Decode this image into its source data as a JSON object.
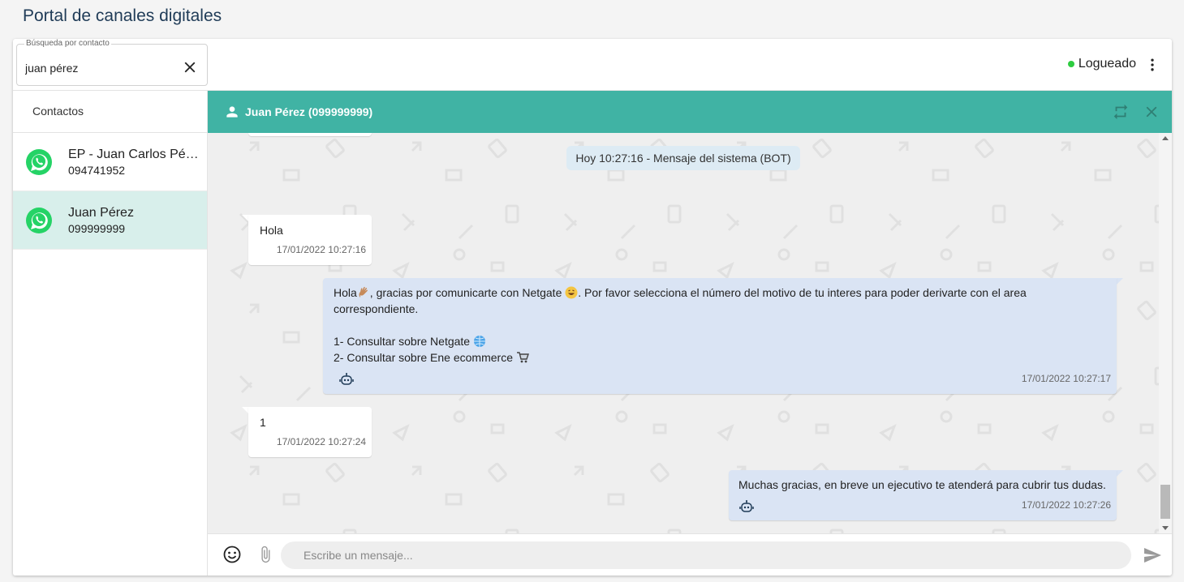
{
  "page": {
    "title": "Portal de canales digitales"
  },
  "search": {
    "label": "Búsqueda por contacto",
    "value": "juan pérez"
  },
  "status": {
    "label": "Logueado",
    "color": "#2ecc40"
  },
  "sidebar": {
    "header": "Contactos",
    "contacts": [
      {
        "name": "EP - Juan Carlos Pérez",
        "phone": "094741952",
        "icon": "whatsapp-icon",
        "active": false
      },
      {
        "name": "Juan Pérez",
        "phone": "099999999",
        "icon": "whatsapp-icon",
        "active": true
      }
    ]
  },
  "chat": {
    "title": "Juan Pérez (099999999)",
    "header_color": "#40b3a4",
    "system_message": "Hoy 10:27:16 - Mensaje del sistema (BOT)",
    "messages": [
      {
        "direction": "in",
        "text": "Hola",
        "time": "17/01/2022 10:27:16"
      },
      {
        "direction": "out",
        "line1_a": "Hola",
        "line1_b": ", gracias por comunicarte con Netgate ",
        "line1_c": ". Por favor selecciona el número del motivo de tu interes para poder derivarte con el area",
        "line2": "correspondiente.",
        "option1": "1- Consultar sobre Netgate ",
        "option2": "2- Consultar sobre Ene ecommerce ",
        "time": "17/01/2022 10:27:17",
        "bot": true
      },
      {
        "direction": "in",
        "text": "1",
        "time": "17/01/2022 10:27:24"
      },
      {
        "direction": "out",
        "text": "Muchas gracias, en breve un ejecutivo te atenderá para cubrir tus dudas.",
        "time": "17/01/2022 10:27:26",
        "bot": true
      }
    ]
  },
  "composer": {
    "placeholder": "Escribe un mensaje..."
  }
}
